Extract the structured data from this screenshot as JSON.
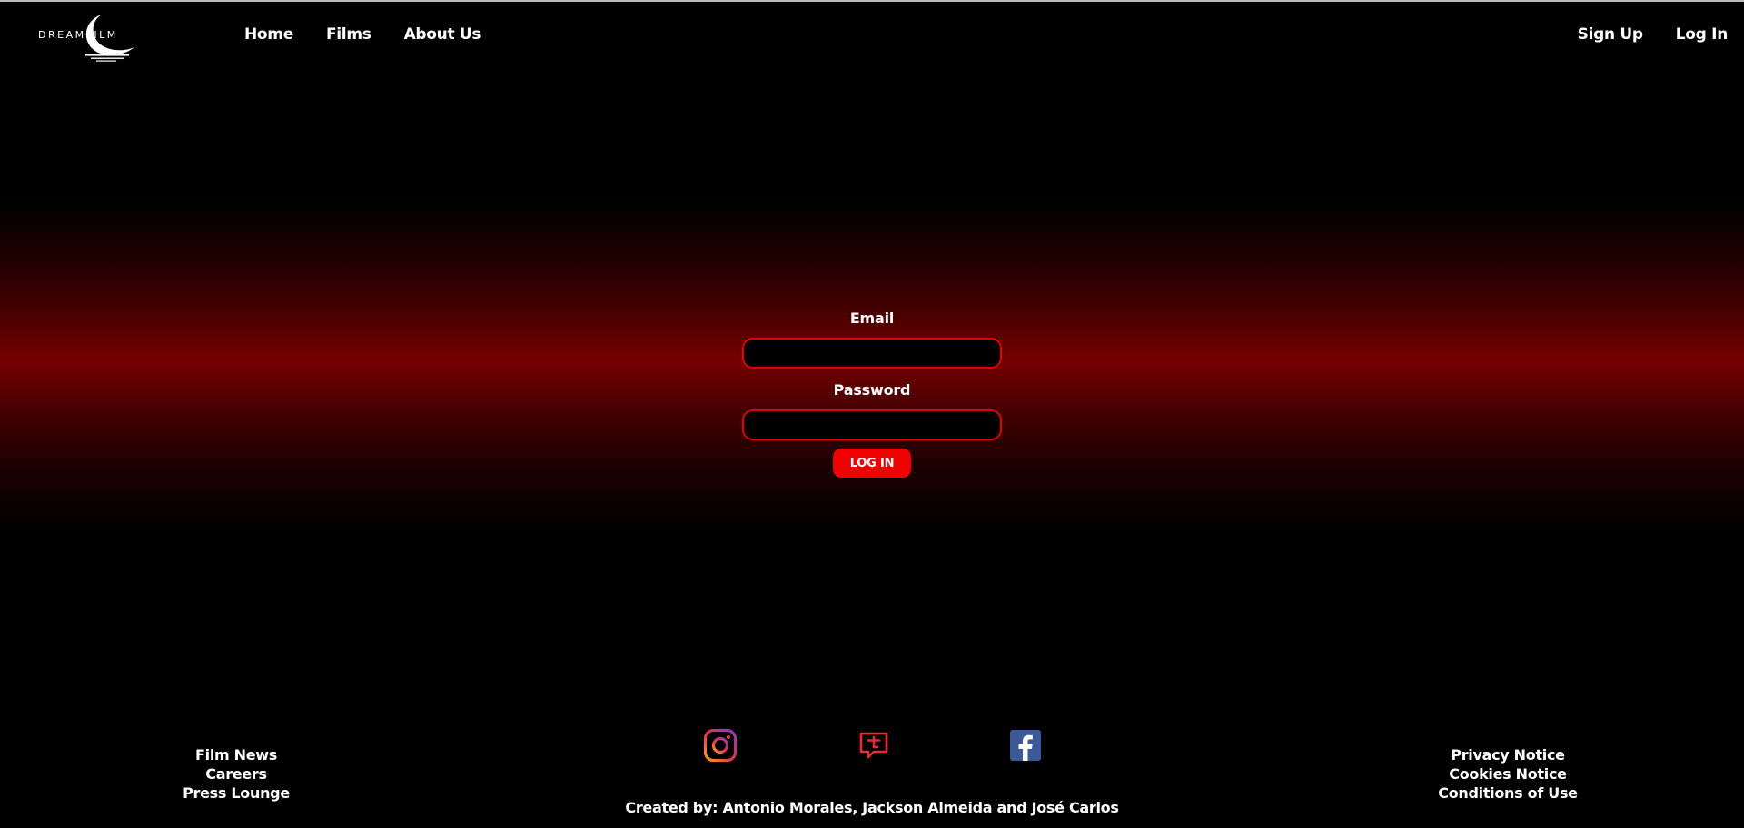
{
  "header": {
    "logo_text": "DREAMFILM",
    "nav_left": [
      "Home",
      "Films",
      "About Us"
    ],
    "nav_right": [
      "Sign Up",
      "Log In"
    ]
  },
  "login": {
    "email_label": "Email",
    "email_value": "",
    "password_label": "Password",
    "password_value": "",
    "button_label": "LOG IN"
  },
  "footer": {
    "left_links": [
      "Film News",
      "Careers",
      "Press Lounge"
    ],
    "right_links": [
      "Privacy Notice",
      "Cookies Notice",
      "Conditions of Use"
    ],
    "social_icons": [
      "instagram-icon",
      "tumblr-icon",
      "facebook-icon"
    ],
    "credits": "Created by: Antonio Morales, Jackson Almeida and José Carlos"
  },
  "colors": {
    "accent": "#f00000",
    "input_border": "#e00000",
    "background": "#000000",
    "glow": "#760000",
    "facebook": "#3b5998"
  }
}
